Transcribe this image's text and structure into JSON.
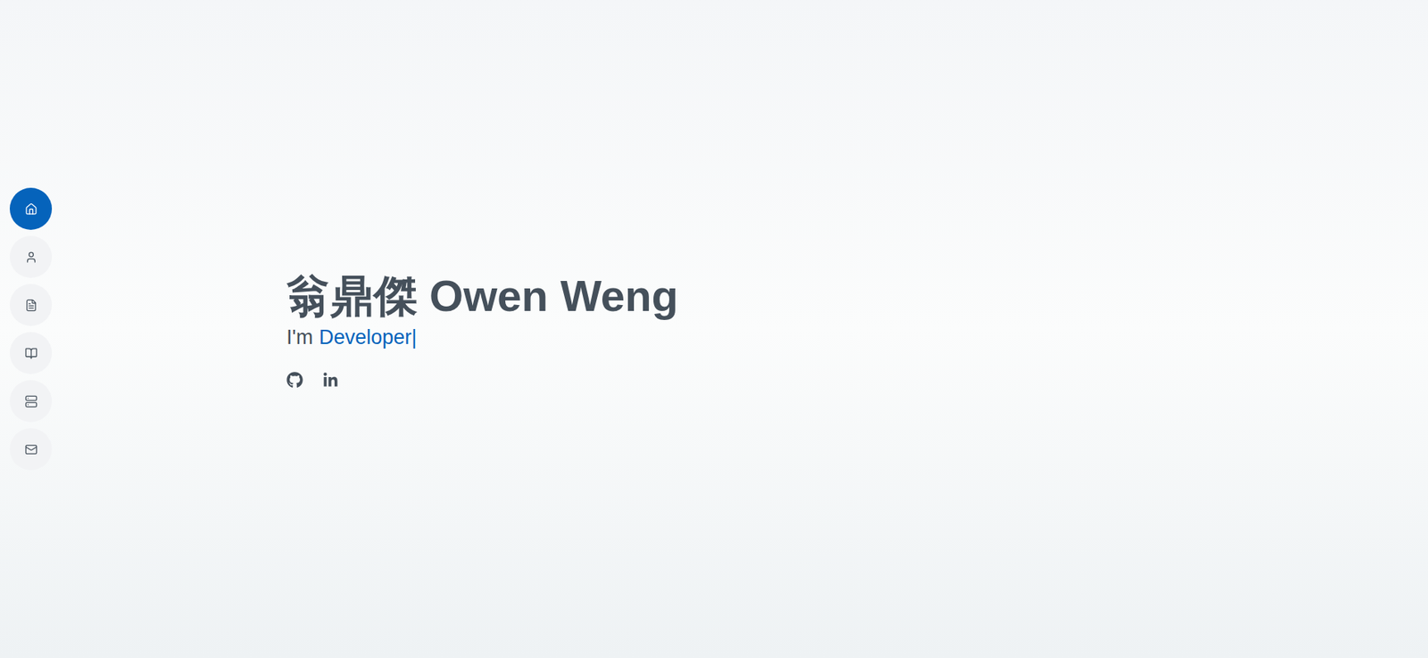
{
  "nav": {
    "items": [
      {
        "selected": true
      },
      {
        "selected": false
      },
      {
        "selected": false
      },
      {
        "selected": false
      },
      {
        "selected": false
      },
      {
        "selected": false
      }
    ]
  },
  "hero": {
    "name": "翁鼎傑 Owen Weng",
    "prefix": "I'm",
    "typed": "Developer",
    "cursor": "|"
  }
}
